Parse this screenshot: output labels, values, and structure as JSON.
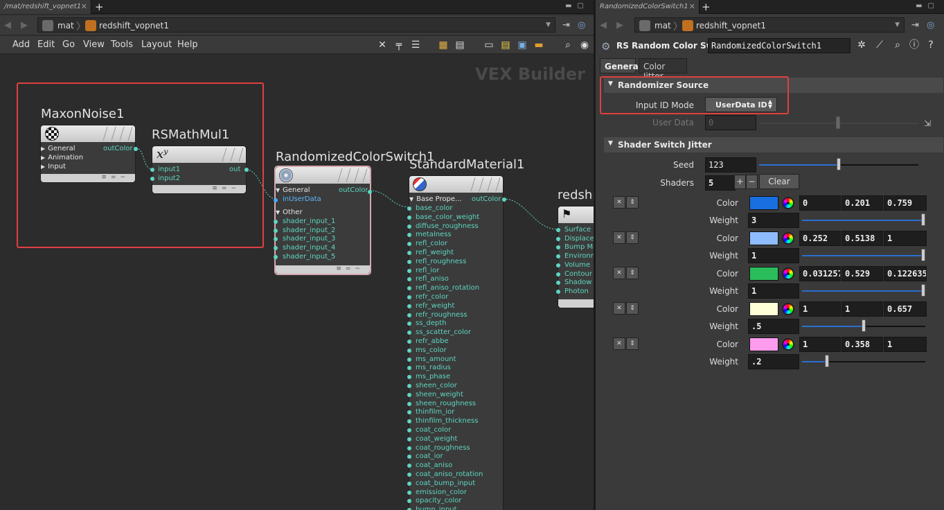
{
  "left": {
    "tab_title": "/mat/redshift_vopnet1",
    "path": [
      "mat",
      "redshift_vopnet1"
    ],
    "menu": [
      "Add",
      "Edit",
      "Go",
      "View",
      "Tools",
      "Layout",
      "Help"
    ],
    "context_label": "VEX Builder",
    "nodes": {
      "maxon": {
        "title": "MaxonNoise1",
        "inputs": [
          "General",
          "Animation",
          "Input"
        ],
        "output": "outColor"
      },
      "mathmul": {
        "title": "RSMathMul1",
        "icon": "xʸ",
        "inputs": [
          "input1",
          "input2"
        ],
        "output": "out"
      },
      "switch": {
        "title": "RandomizedColorSwitch1",
        "groups": [
          "General",
          "Other"
        ],
        "general_inputs": [
          "inUserData"
        ],
        "other_inputs": [
          "shader_input_1",
          "shader_input_2",
          "shader_input_3",
          "shader_input_4",
          "shader_input_5"
        ],
        "output": "outColor"
      },
      "material": {
        "title": "StandardMaterial1",
        "group": "Base Prope...",
        "output": "outColor",
        "inputs": [
          "base_color",
          "base_color_weight",
          "diffuse_roughness",
          "metalness",
          "refl_color",
          "refl_weight",
          "refl_roughness",
          "refl_ior",
          "refl_aniso",
          "refl_aniso_rotation",
          "refr_color",
          "refr_weight",
          "refr_roughness",
          "ss_depth",
          "ss_scatter_color",
          "refr_abbe",
          "ms_color",
          "ms_amount",
          "ms_radius",
          "ms_phase",
          "sheen_color",
          "sheen_weight",
          "sheen_roughness",
          "thinfilm_ior",
          "thinfilm_thickness",
          "coat_color",
          "coat_weight",
          "coat_roughness",
          "coat_ior",
          "coat_aniso",
          "coat_aniso_rotation",
          "coat_bump_input",
          "emission_color",
          "opacity_color",
          "bump_input"
        ]
      },
      "output": {
        "title": "redshi",
        "inputs": [
          "Surface",
          "Displacem",
          "Bump Map",
          "Environm",
          "Volume",
          "Contour",
          "Shadow",
          "Photon"
        ]
      }
    }
  },
  "right": {
    "tab_title": "RandomizedColorSwitch1",
    "path": [
      "mat",
      "redshift_vopnet1"
    ],
    "node_type": "RS Random Color Switch",
    "node_name": "RandomizedColorSwitch1",
    "tabs": [
      "General",
      "Color Jitter"
    ],
    "randomizer": {
      "section": "Randomizer Source",
      "input_id_mode_label": "Input ID Mode",
      "input_id_mode_value": "UserData ID",
      "user_data_label": "User Data",
      "user_data_value": "0"
    },
    "jitter": {
      "section": "Shader Switch Jitter",
      "seed_label": "Seed",
      "seed_value": "123",
      "seed_fraction": 0.5,
      "shaders_label": "Shaders",
      "shaders_value": "5",
      "clear_label": "Clear",
      "color_label": "Color",
      "weight_label": "Weight",
      "entries": [
        {
          "swatch": "#1a6fe0",
          "r": "0",
          "g": "0.201",
          "b": "0.759",
          "weight": "3",
          "weight_fraction": 1.0
        },
        {
          "swatch": "#8ebcff",
          "r": "0.252",
          "g": "0.5138",
          "b": "1",
          "weight": "1",
          "weight_fraction": 1.0
        },
        {
          "swatch": "#2bbd5c",
          "r": "0.031257",
          "g": "0.529",
          "b": "0.122635",
          "weight": "1",
          "weight_fraction": 1.0
        },
        {
          "swatch": "#ffffd8",
          "r": "1",
          "g": "1",
          "b": "0.657",
          "weight": ".5",
          "weight_fraction": 0.5
        },
        {
          "swatch": "#ff9cee",
          "r": "1",
          "g": "0.358",
          "b": "1",
          "weight": ".2",
          "weight_fraction": 0.2
        }
      ]
    }
  }
}
